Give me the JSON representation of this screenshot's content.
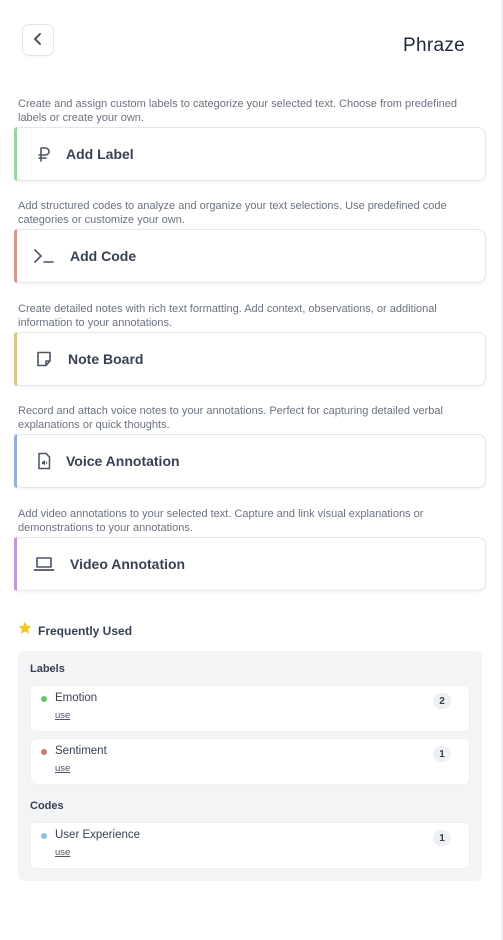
{
  "header": {
    "logo_text": "Phraze"
  },
  "actions": [
    {
      "description": "Create and assign custom labels to categorize your selected text. Choose from predefined labels or create your own.",
      "title": "Add Label",
      "icon": "ruble-icon",
      "accent": "#9dd49b"
    },
    {
      "description": "Add structured codes to analyze and organize your text selections. Use predefined code categories or customize your own.",
      "title": "Add Code",
      "icon": "terminal-icon",
      "accent": "#d19a96"
    },
    {
      "description": "Create detailed notes with rich text formatting. Add context, observations, or additional information to your annotations.",
      "title": "Note Board",
      "icon": "sticky-note-icon",
      "accent": "#d6c98a"
    },
    {
      "description": "Record and attach voice notes to your annotations. Perfect for capturing detailed verbal explanations or quick thoughts.",
      "title": "Voice Annotation",
      "icon": "audio-file-icon",
      "accent": "#9aaed4"
    },
    {
      "description": "Add video annotations to your selected text. Capture and link visual explanations or demonstrations to your annotations.",
      "title": "Video Annotation",
      "icon": "laptop-icon",
      "accent": "#c49ad6"
    }
  ],
  "frequently_used": {
    "title": "Frequently Used",
    "icon": "star-icon",
    "star_color": "#f5c518",
    "groups": [
      {
        "title": "Labels",
        "items": [
          {
            "name": "Emotion",
            "use": "use",
            "count": "2",
            "color": "#6cc46a"
          },
          {
            "name": "Sentiment",
            "use": "use",
            "count": "1",
            "color": "#c77b7b"
          }
        ]
      },
      {
        "title": "Codes",
        "items": [
          {
            "name": "User Experience",
            "use": "use",
            "count": "1",
            "color": "#8cc3d6"
          }
        ]
      }
    ]
  }
}
